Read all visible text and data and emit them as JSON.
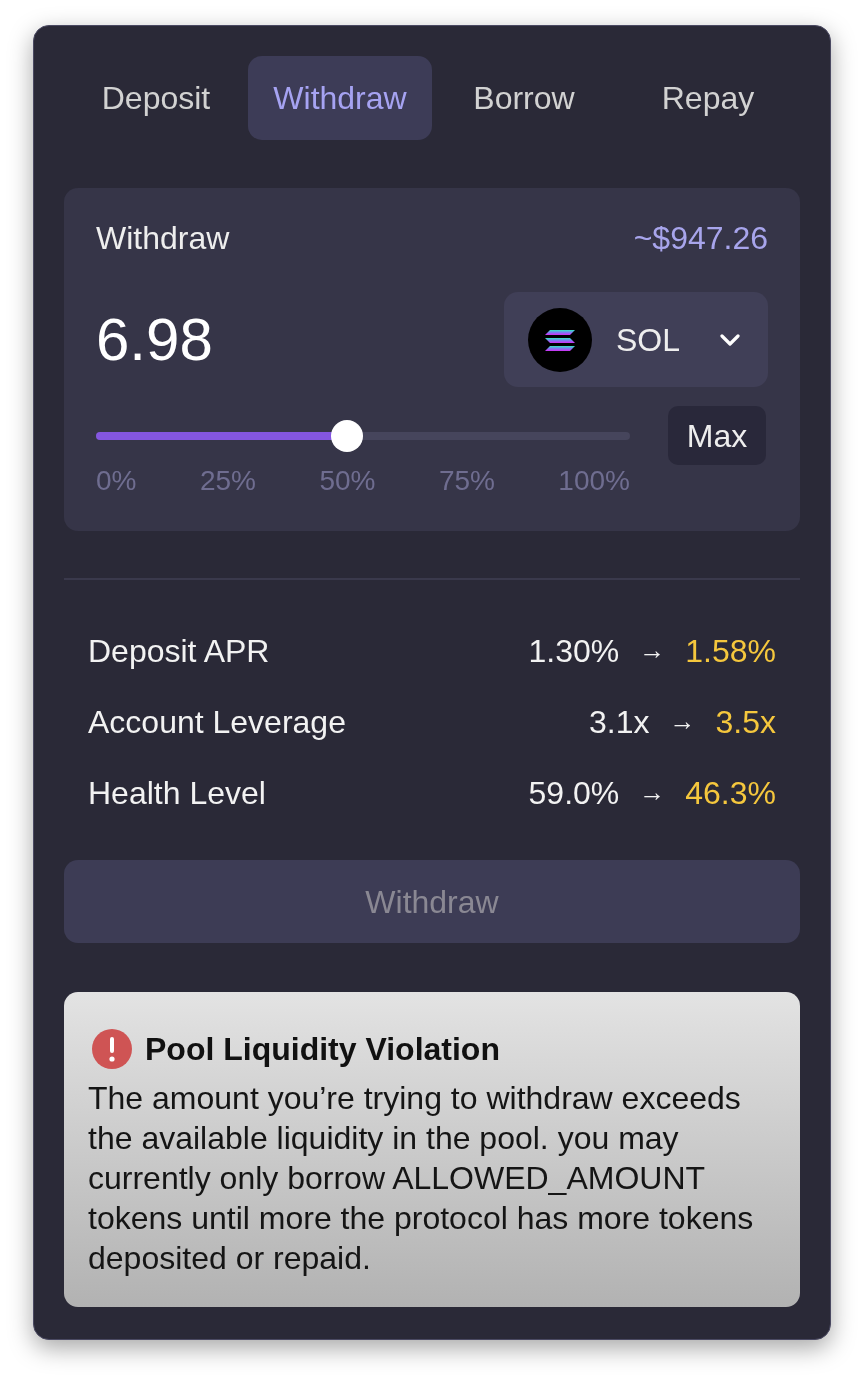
{
  "tabs": [
    {
      "label": "Deposit",
      "selected": false
    },
    {
      "label": "Withdraw",
      "selected": true
    },
    {
      "label": "Borrow",
      "selected": false
    },
    {
      "label": "Repay",
      "selected": false
    }
  ],
  "amount_panel": {
    "label": "Withdraw",
    "usd_value": "~$947.26",
    "amount": "6.98",
    "token": {
      "symbol": "SOL"
    },
    "slider": {
      "level": 0.47,
      "ticks": [
        "0%",
        "25%",
        "50%",
        "75%",
        "100%"
      ]
    },
    "max_button": "Max"
  },
  "stats": [
    {
      "label": "Deposit APR",
      "current": "1.30%",
      "arrow": "→",
      "projected": "1.58%"
    },
    {
      "label": "Account Leverage",
      "current": "3.1x",
      "arrow": "→",
      "projected": "3.5x"
    },
    {
      "label": "Health Level",
      "current": "59.0%",
      "arrow": "→",
      "projected": "46.3%"
    }
  ],
  "submit_button": {
    "label": "Withdraw",
    "disabled": true
  },
  "alert": {
    "title": "Pool Liquidity Violation",
    "message": "The amount you’re trying to withdraw exceeds the available liquidity in the pool. you may currently only borrow ALLOWED_AMOUNT tokens until more the protocol has more tokens deposited or repaid."
  }
}
